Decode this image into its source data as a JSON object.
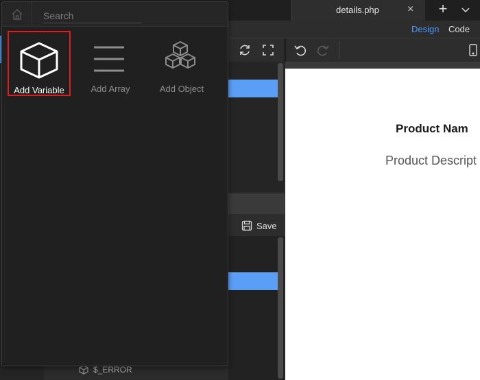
{
  "editor": {
    "tab_title": "details.php",
    "tab_close": "×",
    "new_tab": "+",
    "mode_design": "Design",
    "mode_code": "Code",
    "save_label": "Save",
    "error_item": "$_ERROR"
  },
  "preview": {
    "product_name": "Product Nam",
    "product_description": "Product Descript"
  },
  "popup": {
    "search_placeholder": "Search",
    "search_value": "",
    "options": [
      {
        "label": "Add Variable",
        "icon": "cube-icon",
        "active": true
      },
      {
        "label": "Add Array",
        "icon": "lines-icon",
        "active": false
      },
      {
        "label": "Add Object",
        "icon": "stacked-cubes-icon",
        "active": false
      }
    ]
  },
  "colors": {
    "accent": "#4b98ff",
    "selection": "#5a9ff5",
    "highlight_border": "#e11d1d"
  }
}
